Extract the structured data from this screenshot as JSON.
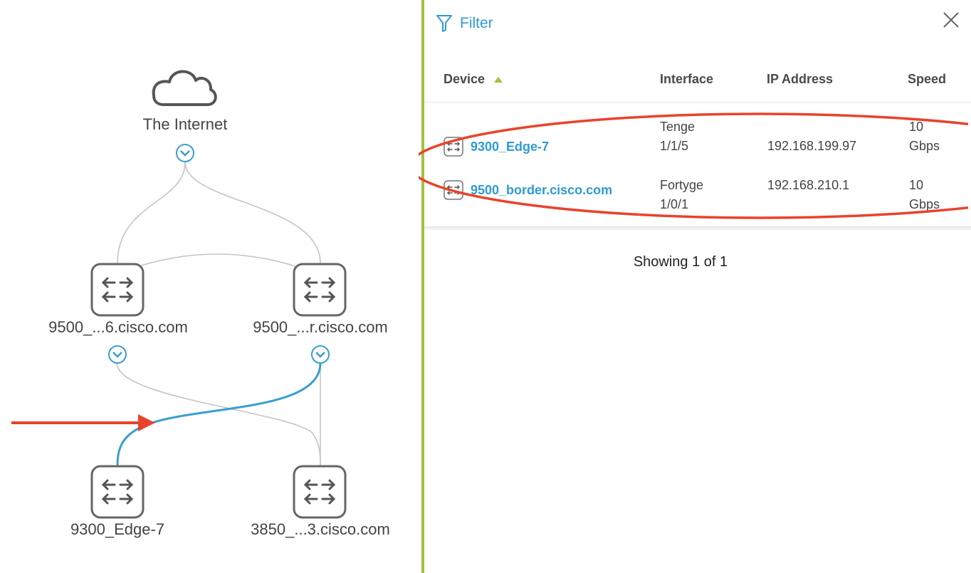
{
  "topology": {
    "internet_label": "The Internet",
    "nodes": [
      {
        "label": "9500_...6.cisco.com"
      },
      {
        "label": "9500_...r.cisco.com"
      },
      {
        "label": "9300_Edge-7"
      },
      {
        "label": "3850_...3.cisco.com"
      }
    ],
    "highlight_color": "#3a9ed2",
    "annotation_color": "#e8432c"
  },
  "panel": {
    "filter_label": "Filter",
    "columns": {
      "device": "Device",
      "interface": "Interface",
      "ip_address": "IP Address",
      "speed": "Speed"
    },
    "rows": [
      {
        "device": "9300_Edge-7",
        "interface_line1": "Tenge",
        "interface_line2": "1/1/5",
        "ip": "192.168.199.97",
        "speed_line1": "10",
        "speed_line2": "Gbps"
      },
      {
        "device": "9500_border.cisco.com",
        "interface_line1": "Fortyge",
        "interface_line2": "1/0/1",
        "ip": "192.168.210.1",
        "speed_line1": "10",
        "speed_line2": "Gbps"
      }
    ],
    "showing": "Showing 1 of 1",
    "accent_color": "#a4c13c",
    "link_color": "#2f9bd4"
  }
}
